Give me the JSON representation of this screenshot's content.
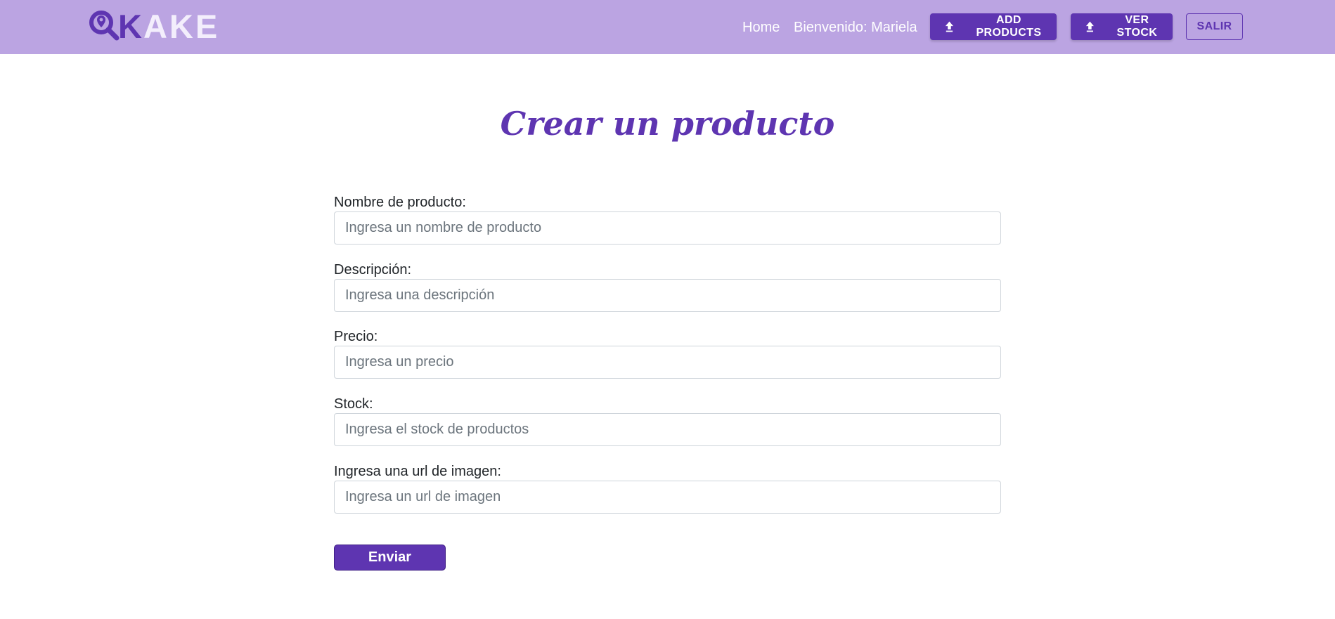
{
  "brand": {
    "logo_first_letter": "K",
    "logo_rest": "AKE",
    "logo_icon": "magnifier-pin-icon"
  },
  "nav": {
    "home": "Home",
    "welcome": "Bienvenido: Mariela",
    "add_products": "ADD PRODUCTS",
    "ver_stock": "VER STOCK",
    "salir": "SALIR",
    "upload_icon": "upload-icon"
  },
  "form": {
    "title": "Crear un producto",
    "fields": [
      {
        "label": "Nombre de producto:",
        "placeholder": "Ingresa un nombre de producto",
        "value": ""
      },
      {
        "label": "Descripción:",
        "placeholder": "Ingresa una descripción",
        "value": ""
      },
      {
        "label": "Precio:",
        "placeholder": "Ingresa un precio",
        "value": ""
      },
      {
        "label": "Stock:",
        "placeholder": "Ingresa el stock de productos",
        "value": ""
      },
      {
        "label": "Ingresa una url de imagen:",
        "placeholder": "Ingresa un url de imagen",
        "value": ""
      }
    ],
    "submit": "Enviar"
  },
  "colors": {
    "navbar_bg": "#bba4e2",
    "primary": "#5e35b1",
    "logo_light": "#f3eefc"
  }
}
